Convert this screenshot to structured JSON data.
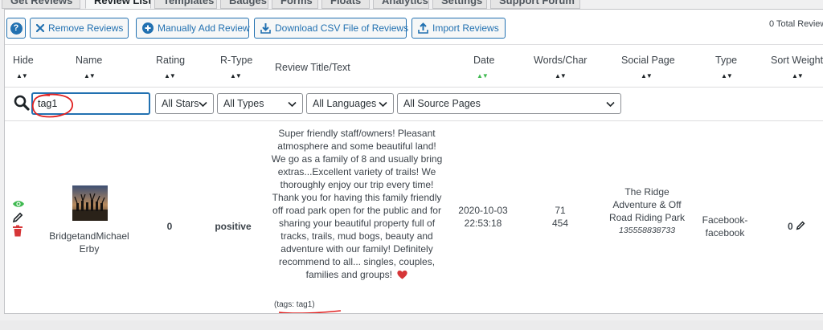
{
  "tabs": [
    {
      "label": "Get Reviews"
    },
    {
      "label": "Review List"
    },
    {
      "label": "Templates"
    },
    {
      "label": "Badges"
    },
    {
      "label": "Forms"
    },
    {
      "label": "Floats"
    },
    {
      "label": "Analytics"
    },
    {
      "label": "Settings"
    },
    {
      "label": "Support Forum"
    }
  ],
  "toolbar": {
    "help_label": "?",
    "remove_label": "Remove Reviews",
    "add_label": "Manually Add Review",
    "download_label": "Download CSV File of Reviews",
    "import_label": "Import Reviews",
    "total": "0 Total Reviews"
  },
  "columns": {
    "hide": "Hide",
    "name": "Name",
    "rating": "Rating",
    "rtype": "R-Type",
    "review": "Review Title/Text",
    "date": "Date",
    "words": "Words/Char",
    "social": "Social Page",
    "type": "Type",
    "sort": "Sort Weight"
  },
  "sort_arrows": "▲▼",
  "filters": {
    "search_value": "tag1",
    "stars": "All Stars",
    "types": "All Types",
    "languages": "All Languages",
    "source": "All Source Pages"
  },
  "review": {
    "name": "BridgetandMichael Erby",
    "rating": "0",
    "rtype": "positive",
    "text": "Super friendly staff/owners! Pleasant atmosphere and some beautiful land! We go as a family of 8 and usually bring extras...Excellent variety of trails! We thoroughly enjoy our trip every time! Thank you for having this family friendly off road park open for the public and for sharing your beautiful property full of tracks, trails, mud bogs, beauty and adventure with our family! Definitely recommend to all... singles, couples, families and groups!",
    "tags": "(tags: tag1)",
    "date": "2020-10-03",
    "time": "22:53:18",
    "words": "71",
    "chars": "454",
    "social_page": "The Ridge Adventure & Off Road Riding Park",
    "social_id": "135558838733",
    "type": "Facebook-facebook",
    "sort_weight": "0"
  },
  "colors": {
    "accent": "#2271b1",
    "visible_icon": "#3fb950",
    "delete_icon": "#d63638",
    "heart": "#d63638",
    "annotation": "#e02020"
  },
  "icons": [
    "help-icon",
    "close-icon",
    "plus-circle-icon",
    "download-icon",
    "upload-icon",
    "search-icon",
    "chevron-down-icon",
    "eye-icon",
    "pencil-icon",
    "trash-icon",
    "heart-icon"
  ]
}
